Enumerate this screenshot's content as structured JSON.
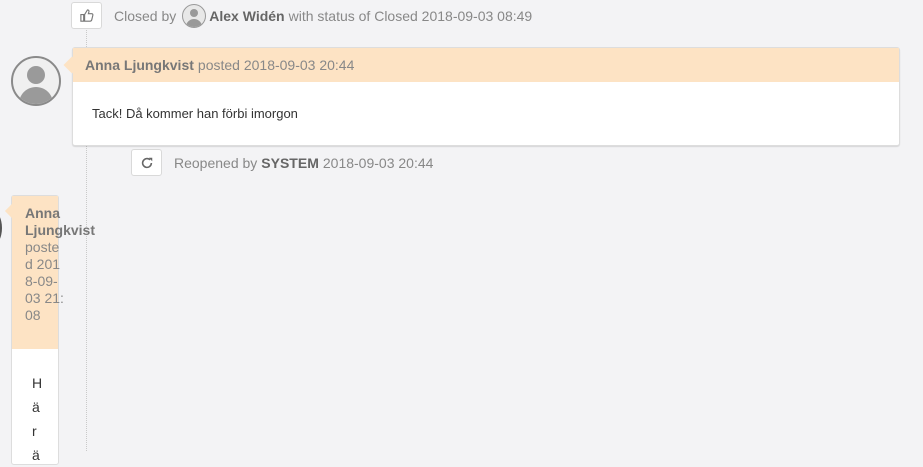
{
  "status_closed": {
    "prefix": "Closed by",
    "user": "Alex Widén",
    "suffix": "with status of Closed 2018-09-03 08:49",
    "icon": "thumbs-up-icon"
  },
  "post1": {
    "author": "Anna Ljungkvist",
    "meta": "posted 2018-09-03 20:44",
    "text": "Tack! Då kommer han förbi imorgon",
    "header_color": "#fde3c4"
  },
  "status_reopened": {
    "prefix": "Reopened by",
    "user": "SYSTEM",
    "suffix": "2018-09-03 20:44",
    "icon": "refresh-icon"
  },
  "post2": {
    "author": "Anna Ljungkvist",
    "meta": "posted 2018-09-03 21:08",
    "text": "Här ä"
  }
}
